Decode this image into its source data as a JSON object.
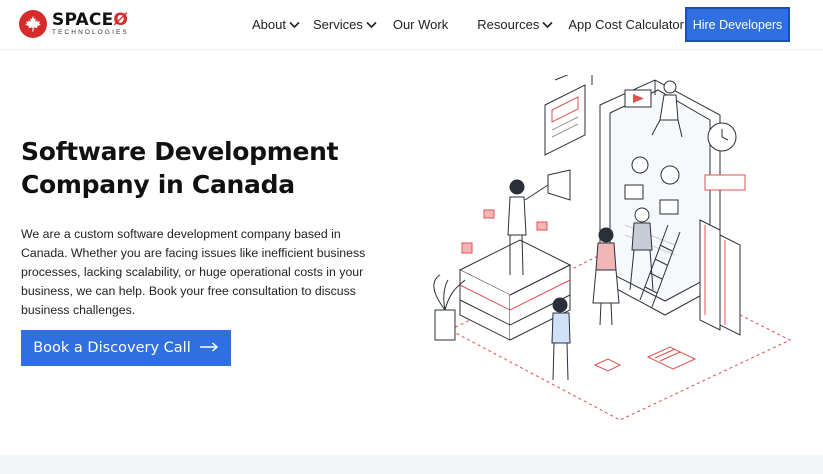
{
  "brand": {
    "name_main": "SPACE",
    "name_mark": "Ø",
    "tagline": "TECHNOLOGIES",
    "accent": "#d62b2b",
    "logo_icon": "maple-leaf-icon"
  },
  "nav": {
    "items": [
      {
        "label": "About",
        "dropdown": true
      },
      {
        "label": "Services",
        "dropdown": true
      },
      {
        "label": "Our Work",
        "dropdown": false
      },
      {
        "label": "Resources",
        "dropdown": true
      },
      {
        "label": "App Cost Calculator",
        "dropdown": false
      }
    ],
    "hire_label": "Hire Developers"
  },
  "hero": {
    "title_line1": "Software Development",
    "title_line2": "Company in Canada",
    "description": "We are a custom software development company based in Canada. Whether you are facing issues like inefficient business processes, lacking scalability, or huge operational costs in your business, we can help. Book your free consultation to discuss business challenges.",
    "cta_label": "Book a Discovery Call",
    "cta_icon": "arrow-right-icon"
  },
  "colors": {
    "primary": "#2f6fe0",
    "text": "#111111",
    "accent_red": "#d62b2b"
  }
}
